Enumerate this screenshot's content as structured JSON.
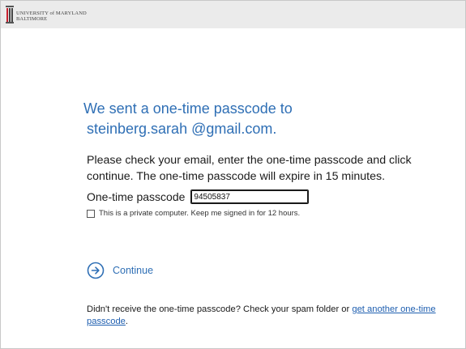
{
  "header": {
    "logo_line1": "UNIVERSITY of MARYLAND",
    "logo_line2": "BALTIMORE",
    "brand_color": "#2f6fb5",
    "topbar_color": "#ebebeb"
  },
  "main": {
    "heading_line1": "We sent a one-time passcode to",
    "heading_line2": "steinberg.sarah @gmail.com.",
    "instructions": "Please check your email, enter the one-time passcode and click continue. The one-time passcode will expire in 15 minutes.",
    "passcode_label": "One-time passcode",
    "passcode_value": "94505837",
    "remember_label": "This is a private computer. Keep me signed in for 12 hours.",
    "remember_checked": false,
    "continue_label": "Continue",
    "continue_icon": "arrow-circle-right-icon",
    "footer_text": "Didn't receive the one-time passcode? Check your spam folder or ",
    "footer_link": "get another one-time passcode",
    "footer_end": "."
  }
}
